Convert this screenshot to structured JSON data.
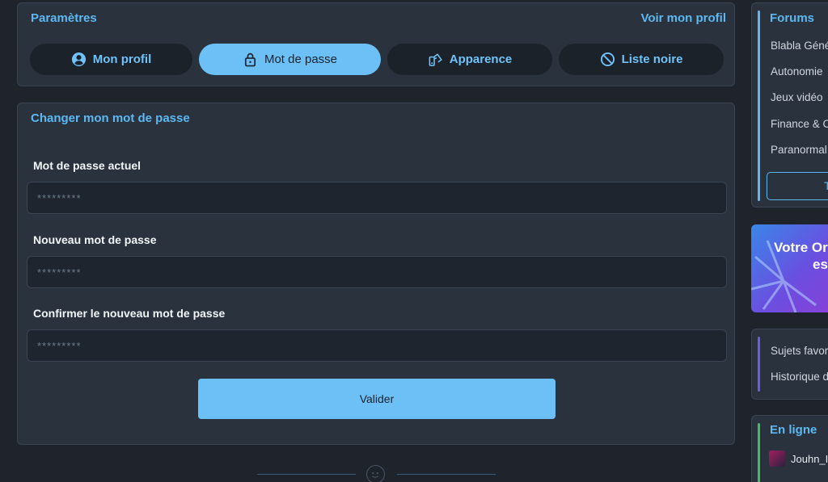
{
  "settings": {
    "title": "Paramètres",
    "profile_link": "Voir mon profil",
    "tabs": [
      {
        "label": "Mon profil",
        "icon": "user-circle-icon"
      },
      {
        "label": "Mot de passe",
        "icon": "lock-icon"
      },
      {
        "label": "Apparence",
        "icon": "palette-icon"
      },
      {
        "label": "Liste noire",
        "icon": "ban-icon"
      }
    ],
    "active_tab": "Mot de passe"
  },
  "form": {
    "title": "Changer mon mot de passe",
    "fields": [
      {
        "label": "Mot de passe actuel",
        "placeholder": "*********"
      },
      {
        "label": "Nouveau mot de passe",
        "placeholder": "*********"
      },
      {
        "label": "Confirmer le nouveau mot de passe",
        "placeholder": "*********"
      }
    ],
    "submit_label": "Valider"
  },
  "sidebar": {
    "forums_title": "Forums",
    "forums": [
      "Blabla Géné",
      "Autonomie",
      "Jeux vidéo",
      "Finance & C",
      "Paranormal"
    ],
    "forums_button": "T",
    "promo_line1": "Votre Or",
    "promo_line2": "es",
    "links": [
      "Sujets favor",
      "Historique d"
    ],
    "online_title": "En ligne",
    "online_users": [
      "Jouhn_I"
    ]
  },
  "colors": {
    "accent": "#5db8f2",
    "active_tab_bg": "#6cc0f6",
    "background": "#1f242c",
    "card": "#2a323d"
  }
}
